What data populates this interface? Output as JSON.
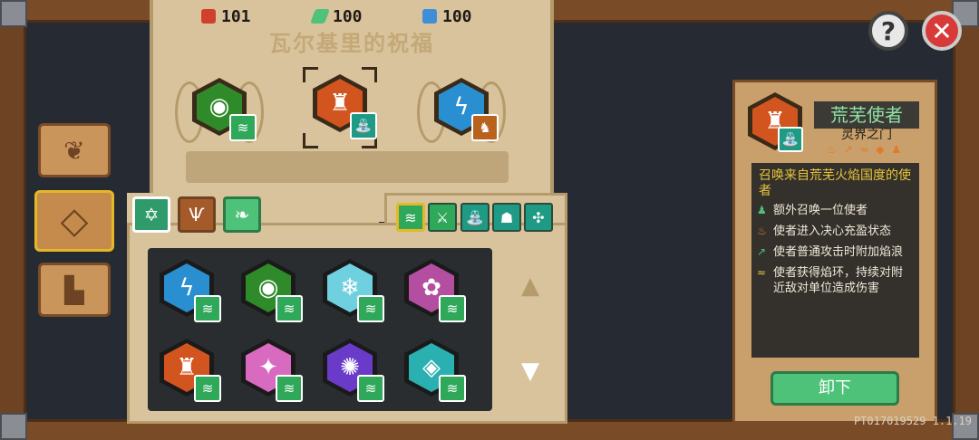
{
  "banner": {
    "title": "瓦尔基里的祝福",
    "slots": [
      {
        "icon": "green-frog-icon",
        "badge": "green-wave-badge",
        "color": "#2f8a2a"
      },
      {
        "icon": "fire-shrine-icon",
        "badge": "teal-summon-badge",
        "color": "#d2541e",
        "selected": true
      },
      {
        "icon": "blue-lightning-icon",
        "badge": "orange-beast-badge",
        "color": "#2a8fd0"
      }
    ],
    "stats": [
      {
        "icon": "fist-icon",
        "value": "101",
        "color": "#d0402c"
      },
      {
        "icon": "leaf-icon",
        "value": "100",
        "color": "#4fc27a"
      },
      {
        "icon": "book-icon",
        "value": "100",
        "color": "#3e8fd8"
      }
    ]
  },
  "nav": [
    {
      "icon": "leaf-nav-icon",
      "glyph": "❦"
    },
    {
      "icon": "diamond-nav-icon",
      "glyph": "◇",
      "active": true
    },
    {
      "icon": "podium-nav-icon",
      "glyph": "▙"
    }
  ],
  "tabs": [
    {
      "icon": "hexagram-tab-icon",
      "glyph": "✡",
      "color": "#2f9a6a",
      "active": true
    },
    {
      "icon": "antlers-tab-icon",
      "glyph": "Ѱ",
      "color": "#a55a2a"
    },
    {
      "icon": "leaf-tab-icon",
      "glyph": "❧",
      "color": "#4fc27a"
    }
  ],
  "filters": [
    {
      "icon": "wave-filter-icon",
      "glyph": "≋",
      "active": true
    },
    {
      "icon": "sword-filter-icon",
      "glyph": "⚔"
    },
    {
      "icon": "summon-filter-icon",
      "glyph": "⛲"
    },
    {
      "icon": "spirit-filter-icon",
      "glyph": "☗"
    },
    {
      "icon": "pinwheel-filter-icon",
      "glyph": "✣"
    }
  ],
  "grid": [
    {
      "icon": "blue-lightning-icon",
      "color": "#2a8fd0",
      "glyph": "ϟ"
    },
    {
      "icon": "green-frog-icon",
      "color": "#2f8a2a",
      "glyph": "◉"
    },
    {
      "icon": "ice-crystal-icon",
      "color": "#6fd0e0",
      "glyph": "❄"
    },
    {
      "icon": "pink-beast-icon",
      "color": "#b44ea0",
      "glyph": "✿"
    },
    {
      "icon": "fire-shrine-icon",
      "color": "#d2541e",
      "glyph": "♜"
    },
    {
      "icon": "pink-hammer-icon",
      "color": "#d86ac0",
      "glyph": "✦"
    },
    {
      "icon": "purple-rune-icon",
      "color": "#6a3ac8",
      "glyph": "✺"
    },
    {
      "icon": "teal-orb-icon",
      "color": "#2ab0b0",
      "glyph": "◈"
    }
  ],
  "detail": {
    "name": "荒芜使者",
    "subtitle": "灵界之门",
    "tag_icons": "♨ ↗ ≈ ◆ ♟",
    "desc_title": "召唤来自荒芜火焰国度的使者",
    "lines": [
      {
        "icon": "summon-line-icon",
        "glyph": "♟",
        "color": "#4fc27a",
        "text": "额外召唤一位使者"
      },
      {
        "icon": "flame-line-icon",
        "glyph": "♨",
        "color": "#e27a2c",
        "text": "使者进入决心充盈状态"
      },
      {
        "icon": "arrow-line-icon",
        "glyph": "↗",
        "color": "#4fc27a",
        "text": "使者普通攻击时附加焰浪"
      },
      {
        "icon": "wave-line-icon",
        "glyph": "≈",
        "color": "#e8c53a",
        "text": "使者获得焰环，持续对附近敌对单位造成伤害"
      }
    ],
    "unequip_label": "卸下"
  },
  "help_label": "?",
  "close_label": "✕",
  "version": "PT017019529 1.1.19"
}
